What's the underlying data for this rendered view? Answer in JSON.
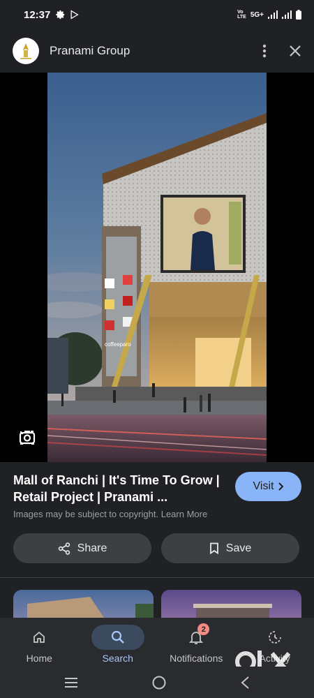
{
  "status_bar": {
    "time": "12:37",
    "network": "5G+",
    "icons": [
      "settings-icon",
      "play-store-icon",
      "volte-icon",
      "signal-icon",
      "signal-icon",
      "battery-icon"
    ]
  },
  "header": {
    "site_name": "Pranami Group",
    "icons": [
      "more-vert-icon",
      "close-icon"
    ]
  },
  "result": {
    "title": "Mall of Ranchi | It's Time To Grow | Retail Project | Pranami ...",
    "visit_label": "Visit",
    "copyright": "Images may be subject to copyright. Learn More",
    "share_label": "Share",
    "save_label": "Save"
  },
  "photo": {
    "storefront_sign": "coffeeparo"
  },
  "bottom_nav": {
    "items": [
      {
        "label": "Home",
        "icon": "home-icon"
      },
      {
        "label": "Search",
        "icon": "search-icon",
        "active": true
      },
      {
        "label": "Notifications",
        "icon": "bell-icon",
        "badge": "2"
      },
      {
        "label": "Activity",
        "icon": "activity-icon"
      }
    ]
  },
  "watermark": "olx",
  "colors": {
    "background": "#202124",
    "accent": "#8ab4f8",
    "button_bg": "#3c4043",
    "badge": "#f28b82"
  }
}
